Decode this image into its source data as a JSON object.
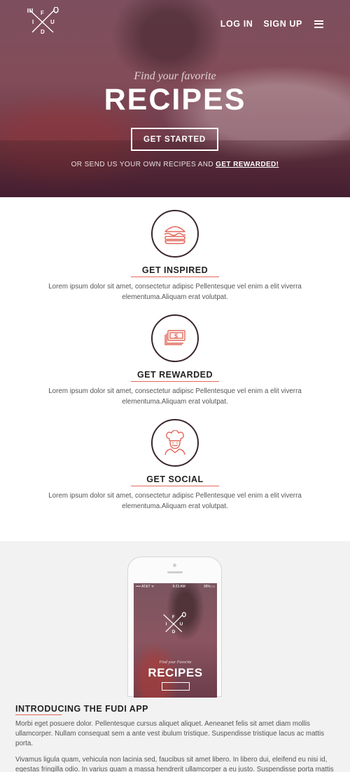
{
  "header": {
    "logo_letters": "FUDI",
    "nav": {
      "login": "LOG IN",
      "signup": "SIGN UP",
      "menu_icon": "hamburger-menu-icon"
    }
  },
  "hero": {
    "tagline": "Find your favorite",
    "title": "RECIPES",
    "cta_label": "GET STARTED",
    "sub_text": "OR SEND US YOUR OWN RECIPES AND ",
    "sub_link": "GET REWARDED!"
  },
  "features": [
    {
      "icon": "burger-icon",
      "title": "GET INSPIRED",
      "text": "Lorem ipsum dolor sit amet, consectetur adipisc Pellentesque vel enim a elit viverra elementuma.Aliquam erat volutpat."
    },
    {
      "icon": "money-icon",
      "title": "GET REWARDED",
      "text": "Lorem ipsum dolor sit amet, consectetur adipisc Pellentesque vel enim a elit viverra elementuma.Aliquam erat volutpat."
    },
    {
      "icon": "chef-icon",
      "title": "GET SOCIAL",
      "text": "Lorem ipsum dolor sit amet, consectetur adipisc Pellentesque vel enim a elit viverra elementuma.Aliquam erat volutpat."
    }
  ],
  "app": {
    "phone_status_left": "•••• AT&T ᯤ",
    "phone_status_time": "9:23 AM",
    "phone_status_right": "36% ▭",
    "phone_tagline": "Find your Favorite",
    "phone_title": "RECIPES",
    "title": "INTRODUCING THE FUDI APP",
    "paragraph1": "Morbi eget posuere dolor. Pellentesque cursus aliquet aliquet. Aeneanet felis sit amet diam mollis ullamcorper. Nullam consequat sem a ante vest ibulum tristique. Suspendisse tristique lacus ac mattis porta.",
    "paragraph2": "Vivamus ligula quam, vehicula non lacinia sed, faucibus sit amet libero. In libero dui, eleifend eu nisi id, egestas fringilla odio. In varius quam a massa hendrerit ullamcorper a eu justo. Suspendisse porta mattis"
  },
  "colors": {
    "accent": "#e2685c",
    "dark": "#3a2530",
    "section_bg": "#f2f2f2"
  }
}
